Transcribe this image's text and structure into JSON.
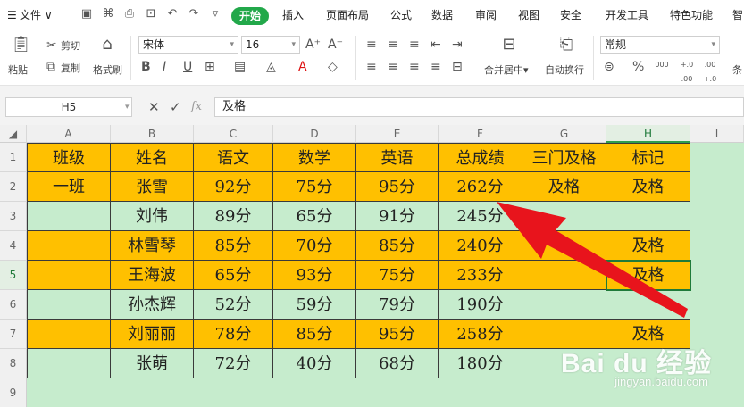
{
  "menubar": {
    "file_label": "文件",
    "tabs": [
      "开始",
      "插入",
      "页面布局",
      "公式",
      "数据",
      "审阅",
      "视图",
      "安全",
      "开发工具",
      "特色功能",
      "智"
    ],
    "active_tab": "开始"
  },
  "ribbon": {
    "paste_label": "粘贴",
    "cut_label": "剪切",
    "copy_label": "复制",
    "format_painter_label": "格式刷",
    "font_name": "宋体",
    "font_size": "16",
    "merge_label": "合并居中",
    "wrap_label": "自动换行",
    "number_format": "常规",
    "bold": "B",
    "italic": "I",
    "underline": "U",
    "percent": "%",
    "thousands": "000",
    "inc_decimal": "+.0 .00",
    "dec_decimal": ".00 +.0",
    "cond_label": "条"
  },
  "formula_bar": {
    "name_box": "H5",
    "fx": "fx",
    "content": "及格"
  },
  "sheet": {
    "columns": [
      "A",
      "B",
      "C",
      "D",
      "E",
      "F",
      "G",
      "H",
      "I"
    ],
    "rows": [
      "1",
      "2",
      "3",
      "4",
      "5",
      "6",
      "7",
      "8",
      "9"
    ],
    "selected_cell": "H5",
    "data": [
      [
        "班级",
        "姓名",
        "语文",
        "数学",
        "英语",
        "总成绩",
        "三门及格",
        "标记"
      ],
      [
        "一班",
        "张雪",
        "92分",
        "75分",
        "95分",
        "262分",
        "及格",
        "及格"
      ],
      [
        "",
        "刘伟",
        "89分",
        "65分",
        "91分",
        "245分",
        "",
        ""
      ],
      [
        "",
        "林雪琴",
        "85分",
        "70分",
        "85分",
        "240分",
        "",
        "及格"
      ],
      [
        "",
        "王海波",
        "65分",
        "93分",
        "75分",
        "233分",
        "",
        "及格"
      ],
      [
        "",
        "孙杰辉",
        "52分",
        "59分",
        "79分",
        "190分",
        "",
        ""
      ],
      [
        "",
        "刘丽丽",
        "78分",
        "85分",
        "95分",
        "258分",
        "",
        "及格"
      ],
      [
        "",
        "张萌",
        "72分",
        "40分",
        "68分",
        "180分",
        "",
        ""
      ]
    ],
    "row_fill": [
      "orange",
      "orange",
      "green",
      "orange",
      "orange",
      "green",
      "orange",
      "green"
    ]
  },
  "colors": {
    "orange": "#ffc000",
    "green": "#c6eccd",
    "accent": "#22a84a",
    "arrow": "#e8141c"
  },
  "watermark": {
    "brand": "Bai du 经验",
    "url": "jingyan.baidu.com"
  }
}
